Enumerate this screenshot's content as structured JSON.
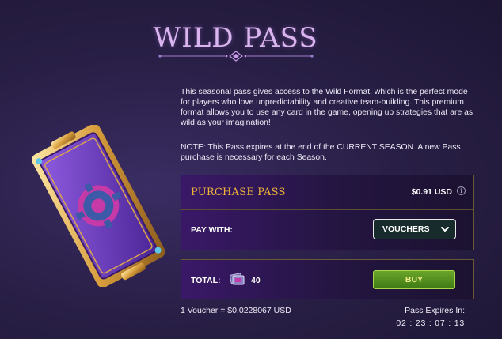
{
  "title": "WILD PASS",
  "description": "This seasonal pass gives access to the Wild Format, which is the perfect mode for players who love unpredictability and creative team-building. This premium format allows you to use any card in the game, opening up strategies that are as wild as your imagination!",
  "note": "NOTE: This Pass expires at the end of the CURRENT SEASON. A new Pass purchase is necessary for each Season.",
  "purchase": {
    "label": "PURCHASE PASS",
    "price": "$0.91 USD",
    "info_icon": "info-icon"
  },
  "pay_with": {
    "label": "PAY WITH:",
    "selected": "VOUCHERS"
  },
  "total": {
    "label": "TOTAL:",
    "amount": "40",
    "icon": "voucher-icon"
  },
  "buy_label": "BUY",
  "rate_text": "1 Voucher = $0.0228067 USD",
  "expires": {
    "label": "Pass Expires In:",
    "value": "02 : 23 : 07 : 13"
  },
  "colors": {
    "title": "#d9b4ef",
    "purchase_label": "#f0b43a",
    "buy_bg": "#5a9622",
    "buy_text": "#f3f08a",
    "panel_border": "#6a5a34"
  }
}
